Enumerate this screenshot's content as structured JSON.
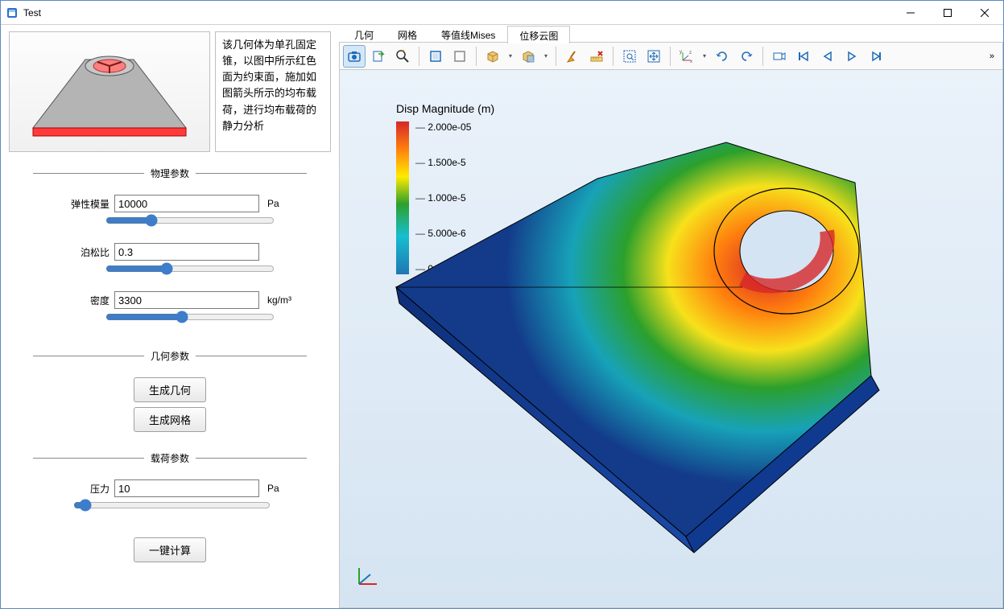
{
  "window": {
    "title": "Test"
  },
  "description": "该几何体为单孔固定锥，以图中所示红色面为约束面，施加如图箭头所示的均布载荷，进行均布载荷的静力分析",
  "groups": {
    "physics": "物理参数",
    "geometry": "几何参数",
    "load": "载荷参数"
  },
  "params": {
    "elastic": {
      "label": "弹性模量",
      "value": "10000",
      "unit": "Pa"
    },
    "poisson": {
      "label": "泊松比",
      "value": "0.3",
      "unit": ""
    },
    "density": {
      "label": "密度",
      "value": "3300",
      "unit": "kg/m³"
    },
    "pressure": {
      "label": "压力",
      "value": "10",
      "unit": "Pa"
    }
  },
  "buttons": {
    "genGeom": "生成几何",
    "genMesh": "生成网格",
    "compute": "一键计算"
  },
  "tabs": [
    {
      "label": "几何"
    },
    {
      "label": "网格"
    },
    {
      "label": "等值线Mises"
    },
    {
      "label": "位移云图"
    }
  ],
  "activeTab": 3,
  "legend": {
    "title": "Disp Magnitude (m)",
    "ticks": [
      "2.000e-05",
      "1.500e-5",
      "1.000e-5",
      "5.000e-6",
      "0.000e+00"
    ]
  },
  "toolbar": {
    "overflow": "»"
  },
  "chart_data": {
    "type": "heatmap",
    "title": "Disp Magnitude (m)",
    "colormap": "jet",
    "range": [
      0.0,
      2e-05
    ],
    "ticks": [
      0.0,
      5e-06,
      1e-05,
      1.5e-05,
      2e-05
    ],
    "unit": "m",
    "note": "FEA displacement magnitude contour on single-hole fixed wedge geometry"
  }
}
